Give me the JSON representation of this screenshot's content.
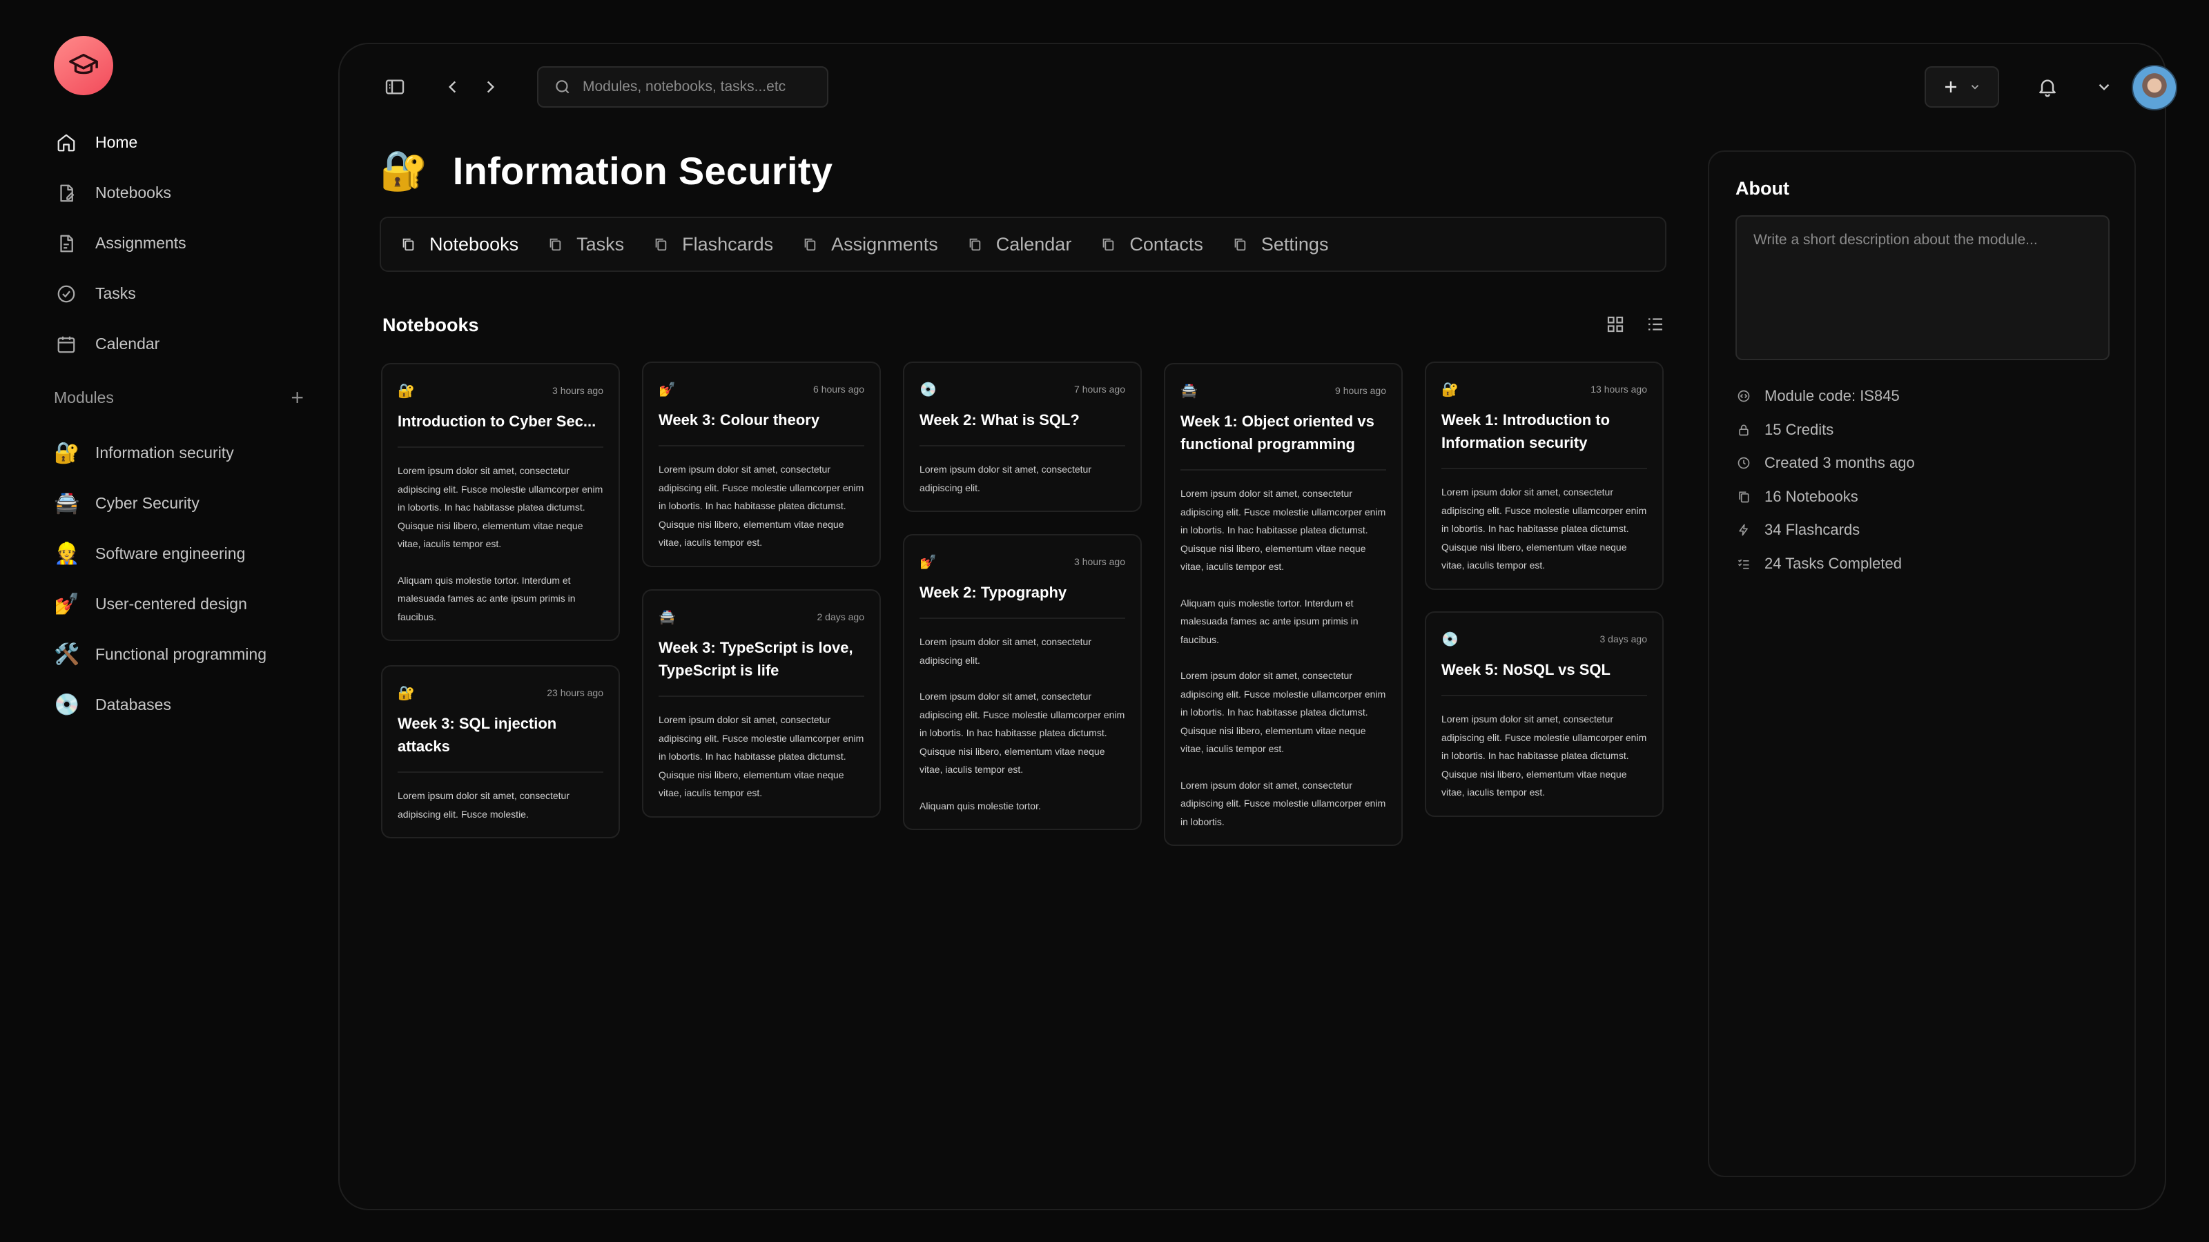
{
  "colors": {
    "background": "#090909",
    "accent": "#f24a5a",
    "card": "#0e0e0e"
  },
  "sidebar": {
    "logo_icon": "graduation-cap-icon",
    "nav": [
      {
        "label": "Home",
        "icon": "home-icon"
      },
      {
        "label": "Notebooks",
        "icon": "notebook-icon"
      },
      {
        "label": "Assignments",
        "icon": "assignment-icon"
      },
      {
        "label": "Tasks",
        "icon": "check-circle-icon"
      },
      {
        "label": "Calendar",
        "icon": "calendar-icon"
      }
    ],
    "modules_label": "Modules",
    "modules": [
      {
        "label": "Information security",
        "emoji": "🔐"
      },
      {
        "label": "Cyber Security",
        "emoji": "🚔"
      },
      {
        "label": "Software engineering",
        "emoji": "👷"
      },
      {
        "label": "User-centered design",
        "emoji": "💅"
      },
      {
        "label": "Functional programming",
        "emoji": "🛠️"
      },
      {
        "label": "Databases",
        "emoji": "💿"
      }
    ]
  },
  "topbar": {
    "search_placeholder": "Modules, notebooks, tasks...etc"
  },
  "page": {
    "emoji": "🔐",
    "title": "Information Security",
    "tabs": [
      "Notebooks",
      "Tasks",
      "Flashcards",
      "Assignments",
      "Calendar",
      "Contacts",
      "Settings"
    ],
    "section_title": "Notebooks"
  },
  "cards": [
    {
      "emoji": "🔐",
      "time": "3 hours ago",
      "title": "Introduction to Cyber Sec...",
      "paras": [
        "Lorem ipsum dolor sit amet, consectetur adipiscing elit. Fusce molestie ullamcorper enim in lobortis. In hac habitasse platea dictumst. Quisque nisi libero, elementum vitae neque vitae, iaculis tempor est.",
        "Aliquam quis molestie tortor. Interdum et malesuada fames ac ante ipsum primis in faucibus."
      ]
    },
    {
      "emoji": "🔐",
      "time": "23 hours ago",
      "title": "Week 3: SQL injection attacks",
      "paras": [
        "Lorem ipsum dolor sit amet, consectetur adipiscing elit. Fusce molestie."
      ]
    },
    {
      "emoji": "💅",
      "time": "6 hours ago",
      "title": "Week 3: Colour theory",
      "paras": [
        "Lorem ipsum dolor sit amet, consectetur adipiscing elit. Fusce molestie ullamcorper enim in lobortis. In hac habitasse platea dictumst. Quisque nisi libero, elementum vitae neque vitae, iaculis tempor est."
      ]
    },
    {
      "emoji": "🚔",
      "time": "2 days ago",
      "title": "Week 3: TypeScript is love, TypeScript is life",
      "paras": [
        "Lorem ipsum dolor sit amet, consectetur adipiscing elit. Fusce molestie ullamcorper enim in lobortis. In hac habitasse platea dictumst. Quisque nisi libero, elementum vitae neque vitae, iaculis tempor est."
      ]
    },
    {
      "emoji": "💿",
      "time": "7 hours ago",
      "title": "Week 2: What is SQL?",
      "paras": [
        "Lorem ipsum dolor sit amet, consectetur adipiscing elit."
      ]
    },
    {
      "emoji": "💅",
      "time": "3 hours ago",
      "title": "Week 2: Typography",
      "paras": [
        "Lorem ipsum dolor sit amet, consectetur adipiscing elit.",
        "Lorem ipsum dolor sit amet, consectetur adipiscing elit. Fusce molestie ullamcorper enim in lobortis. In hac habitasse platea dictumst. Quisque nisi libero, elementum vitae neque vitae, iaculis tempor est.",
        "Aliquam quis molestie tortor."
      ]
    },
    {
      "emoji": "🚔",
      "time": "9 hours ago",
      "title": "Week 1: Object oriented vs functional programming",
      "paras": [
        "Lorem ipsum dolor sit amet, consectetur adipiscing elit. Fusce molestie ullamcorper enim in lobortis. In hac habitasse platea dictumst. Quisque nisi libero, elementum vitae neque vitae, iaculis tempor est.",
        "Aliquam quis molestie tortor. Interdum et malesuada fames ac ante ipsum primis in faucibus.",
        "Lorem ipsum dolor sit amet, consectetur adipiscing elit. Fusce molestie ullamcorper enim in lobortis. In hac habitasse platea dictumst. Quisque nisi libero, elementum vitae neque vitae, iaculis tempor est.",
        "Lorem ipsum dolor sit amet, consectetur adipiscing elit. Fusce molestie ullamcorper enim in lobortis."
      ]
    },
    {
      "emoji": "🔐",
      "time": "13 hours ago",
      "title": "Week 1: Introduction to Information security",
      "paras": [
        "Lorem ipsum dolor sit amet, consectetur adipiscing elit. Fusce molestie ullamcorper enim in lobortis. In hac habitasse platea dictumst. Quisque nisi libero, elementum vitae neque vitae, iaculis tempor est."
      ]
    },
    {
      "emoji": "💿",
      "time": "3 days ago",
      "title": "Week 5: NoSQL vs SQL",
      "paras": [
        "Lorem ipsum dolor sit amet, consectetur adipiscing elit. Fusce molestie ullamcorper enim in lobortis. In hac habitasse platea dictumst. Quisque nisi libero, elementum vitae neque vitae, iaculis tempor est."
      ]
    }
  ],
  "about": {
    "title": "About",
    "placeholder": "Write a short description about the module...",
    "stats": [
      {
        "label": "Module code: IS845",
        "icon": "code-icon"
      },
      {
        "label": "15 Credits",
        "icon": "lock-icon"
      },
      {
        "label": "Created 3 months ago",
        "icon": "clock-icon"
      },
      {
        "label": "16 Notebooks",
        "icon": "notebook-icon"
      },
      {
        "label": "34 Flashcards",
        "icon": "lightning-icon"
      },
      {
        "label": "24 Tasks Completed",
        "icon": "list-check-icon"
      }
    ]
  }
}
